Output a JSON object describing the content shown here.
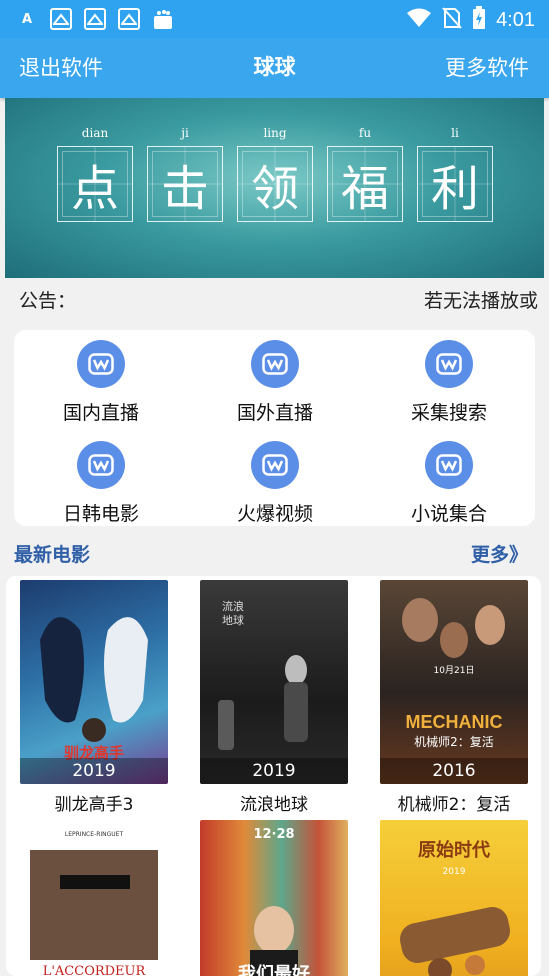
{
  "status_bar": {
    "time": "4:01",
    "icons": [
      "font-a-icon",
      "bird-app-icon",
      "bird-app-icon",
      "bird-app-icon",
      "shopping-bag-icon",
      "wifi-icon",
      "no-sim-icon",
      "battery-charging-icon"
    ]
  },
  "header": {
    "left_label": "退出软件",
    "title": "球球",
    "right_label": "更多软件"
  },
  "banner": {
    "chars": [
      {
        "pinyin": "dian",
        "char": "点"
      },
      {
        "pinyin": "ji",
        "char": "击"
      },
      {
        "pinyin": "ling",
        "char": "领"
      },
      {
        "pinyin": "fu",
        "char": "福"
      },
      {
        "pinyin": "li",
        "char": "利"
      }
    ]
  },
  "notice": {
    "label": "公告：",
    "text": "若无法播放或"
  },
  "menu": {
    "items": [
      {
        "label": "国内直播",
        "icon": "w-logo-icon"
      },
      {
        "label": "国外直播",
        "icon": "w-logo-icon"
      },
      {
        "label": "采集搜索",
        "icon": "w-logo-icon"
      },
      {
        "label": "日韩电影",
        "icon": "w-logo-icon"
      },
      {
        "label": "火爆视频",
        "icon": "w-logo-icon"
      },
      {
        "label": "小说集合",
        "icon": "w-logo-icon"
      }
    ]
  },
  "latest": {
    "title": "最新电影",
    "more": "更多》",
    "movies": [
      {
        "title": "驯龙高手3",
        "year": "2019"
      },
      {
        "title": "流浪地球",
        "year": "2019"
      },
      {
        "title": "机械师2：复活",
        "year": "2016"
      },
      {
        "title": "",
        "year": "",
        "poster_text": "L'ACCORDEUR"
      },
      {
        "title": "",
        "year": "",
        "poster_text": "我们最好"
      },
      {
        "title": "",
        "year": "",
        "poster_text": "2019"
      }
    ]
  },
  "colors": {
    "primary": "#3aa6ee",
    "status_bar": "#2fa3f0",
    "section_title": "#2f5fa7",
    "menu_icon": "#5b8ee6"
  }
}
